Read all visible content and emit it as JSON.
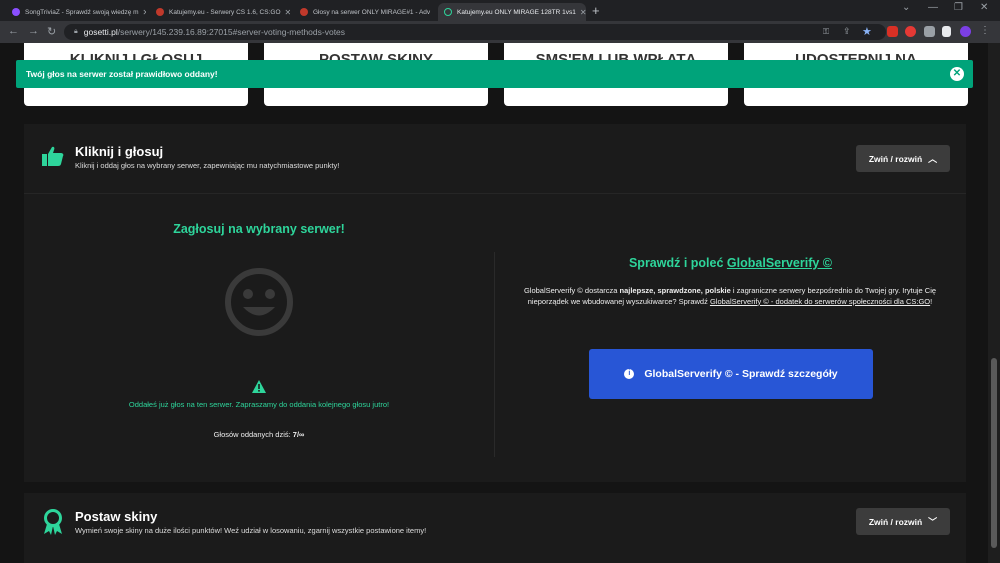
{
  "browser": {
    "tabs": [
      {
        "title": "SongTriviaZ - Sprawdź swoją wiedzę m",
        "color": "#8a4fff"
      },
      {
        "title": "Katujemy.eu - Serwery CS 1.6, CS:GO",
        "color": "#c0392b"
      },
      {
        "title": "Głosy na serwer ONLY MIRAGE#1 - Adv",
        "color": "#c0392b"
      },
      {
        "title": "Katujemy.eu ONLY MIRAGE 128TR 1vs1",
        "color": "#2ed59b"
      }
    ],
    "url_host": "gosetti.pl",
    "url_path": "/serwery/145.239.16.89:27015#server-voting-methods-votes"
  },
  "top_cards": [
    "KLIKNIJ I GŁOSUJ",
    "POSTAW SKINY",
    "SMS'EM LUB WPŁATĄ",
    "UDOSTĘPNIJ NA"
  ],
  "toast": {
    "message": "Twój głos na serwer został prawidłowo oddany!",
    "close_icon": "close-icon"
  },
  "vote_panel": {
    "title": "Kliknij i głosuj",
    "subtitle": "Kliknij i oddaj głos na wybrany serwer, zapewniając mu natychmiastowe punkty!",
    "toggle_label": "Zwiń / rozwiń",
    "vote_heading": "Zagłosuj na wybrany serwer!",
    "voted_message": "Oddałeś już głos na ten serwer. Zapraszamy do oddania kolejnego głosu jutro!",
    "count_label": "Głosów oddanych dziś:",
    "count_value": "7/∞",
    "promo_prefix": "Sprawdź i poleć",
    "promo_link": "GlobalServerify ©",
    "promo_desc_1": "GlobalServerify © dostarcza ",
    "promo_desc_bold": "najlepsze, sprawdzone, polskie",
    "promo_desc_2": " i zagraniczne serwery bezpośrednio do Twojej gry. Irytuje Cię nieporządek we wbudowanej wyszukiwarce? Sprawdź ",
    "promo_desc_link": "GlobalServerify © - dodatek do serwerów społeczności dla CS:GO",
    "promo_desc_end": "!",
    "promo_button": "GlobalServerify © - Sprawdź szczegóły"
  },
  "skins_panel": {
    "title": "Postaw skiny",
    "subtitle": "Wymień swoje skiny na duże ilości punktów! Weź udział w losowaniu, zgarnij wszystkie postawione itemy!",
    "toggle_label": "Zwiń / rozwiń"
  },
  "colors": {
    "accent": "#2ed59b",
    "toast": "#00a37a",
    "button_blue": "#2856d6"
  }
}
